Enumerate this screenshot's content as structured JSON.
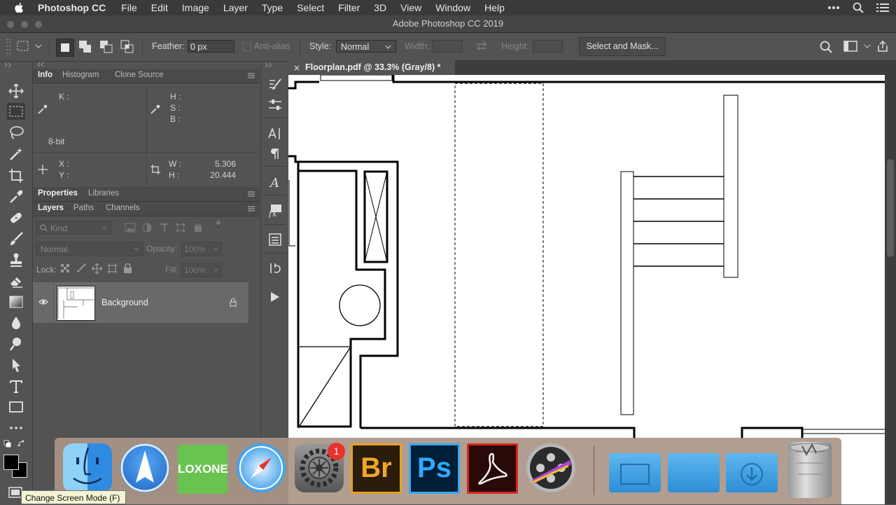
{
  "menubar": {
    "app_name": "Photoshop CC",
    "items": [
      "File",
      "Edit",
      "Image",
      "Layer",
      "Type",
      "Select",
      "Filter",
      "3D",
      "View",
      "Window",
      "Help"
    ]
  },
  "window": {
    "title": "Adobe Photoshop CC 2019"
  },
  "options": {
    "feather_label": "Feather:",
    "feather_value": "0 px",
    "antialias_label": "Anti-alias",
    "style_label": "Style:",
    "style_value": "Normal",
    "width_label": "Width:",
    "height_label": "Height:",
    "select_mask_label": "Select and Mask..."
  },
  "info_panel": {
    "tabs": [
      "Info",
      "Histogram",
      "Clone Source"
    ],
    "k_label": "K :",
    "h_label": "H :",
    "s_label": "S :",
    "b_label": "B :",
    "bit_depth": "8-bit",
    "x_label": "X :",
    "y_label": "Y :",
    "w_label": "W :",
    "h2_label": "H :",
    "w_value": "5.306",
    "h_value": "20.444"
  },
  "props_panel": {
    "tabs": [
      "Properties",
      "Libraries"
    ]
  },
  "layers_panel": {
    "tabs": [
      "Layers",
      "Paths",
      "Channels"
    ],
    "kind_label": "Kind",
    "blend_mode": "Normal",
    "opacity_label": "Opacity:",
    "opacity_value": "100%",
    "lock_label": "Lock:",
    "fill_label": "Fill:",
    "fill_value": "100%",
    "layers": [
      {
        "name": "Background"
      }
    ]
  },
  "document": {
    "tab_title": "Floorplan.pdf @ 33.3% (Gray/8) *"
  },
  "dock": {
    "loxone_label": "LOXONE",
    "bridge_label": "Br",
    "photoshop_label": "Ps",
    "badge_count": "1"
  },
  "tooltip": {
    "text": "Change Screen Mode (F)"
  },
  "colors": {
    "ui_bg": "#535353",
    "panel_dark": "#4a4a4a",
    "selected_layer": "#6a6a6a",
    "ps_blue": "#31a8ff",
    "br_orange": "#e8a020",
    "acrobat_red": "#d32a1f",
    "loxone_green": "#69c350",
    "badge_red": "#e8322b"
  }
}
